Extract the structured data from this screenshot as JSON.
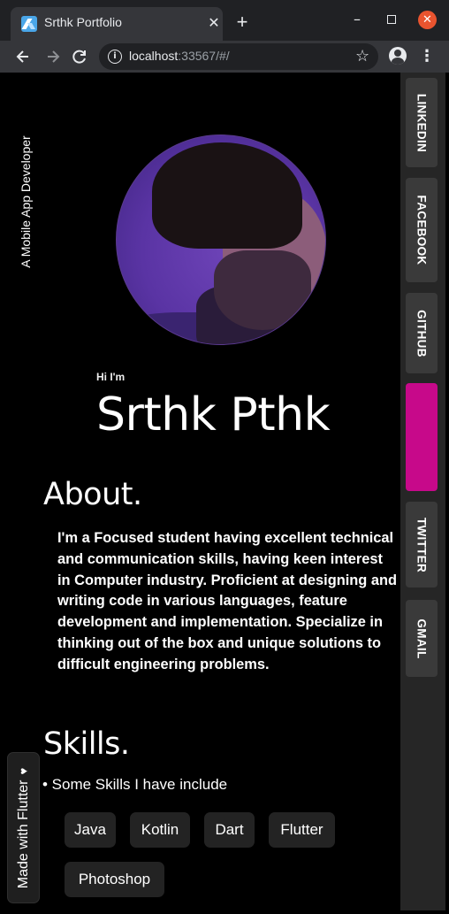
{
  "browser": {
    "tab_title": "Srthk Portfolio",
    "tab_close": "✕",
    "new_tab": "+",
    "url_host": "localhost",
    "url_rest": ":33567/#/",
    "win_minimize": "–",
    "win_close": "✕"
  },
  "page": {
    "tagline": "A Mobile App Developer",
    "greeting": "Hi I'm",
    "name": "Srthk Pthk",
    "about": {
      "heading": "About.",
      "text": "I'm a Focused student having excellent technical and communication skills, having keen interest in Computer industry. Proficient at designing and writing code in various languages, feature development and implementation. Specialize in thinking out of the box and unique solutions to difficult engineering problems."
    },
    "skills": {
      "heading": "Skills.",
      "intro": "• Some Skills I have include",
      "items": [
        "Java",
        "Kotlin",
        "Dart",
        "Flutter",
        "Photoshop"
      ]
    },
    "made_with": "Made with Flutter",
    "heart": "♥"
  },
  "social": {
    "items": [
      "LINKEDIN",
      "FACEBOOK",
      "GITHUB",
      "",
      "TWITTER",
      "GMAIL"
    ],
    "active_color": "#c7098a"
  },
  "colors": {
    "background": "#000000",
    "chrome": "#202124",
    "rail": "#262626",
    "chip": "#232323"
  }
}
